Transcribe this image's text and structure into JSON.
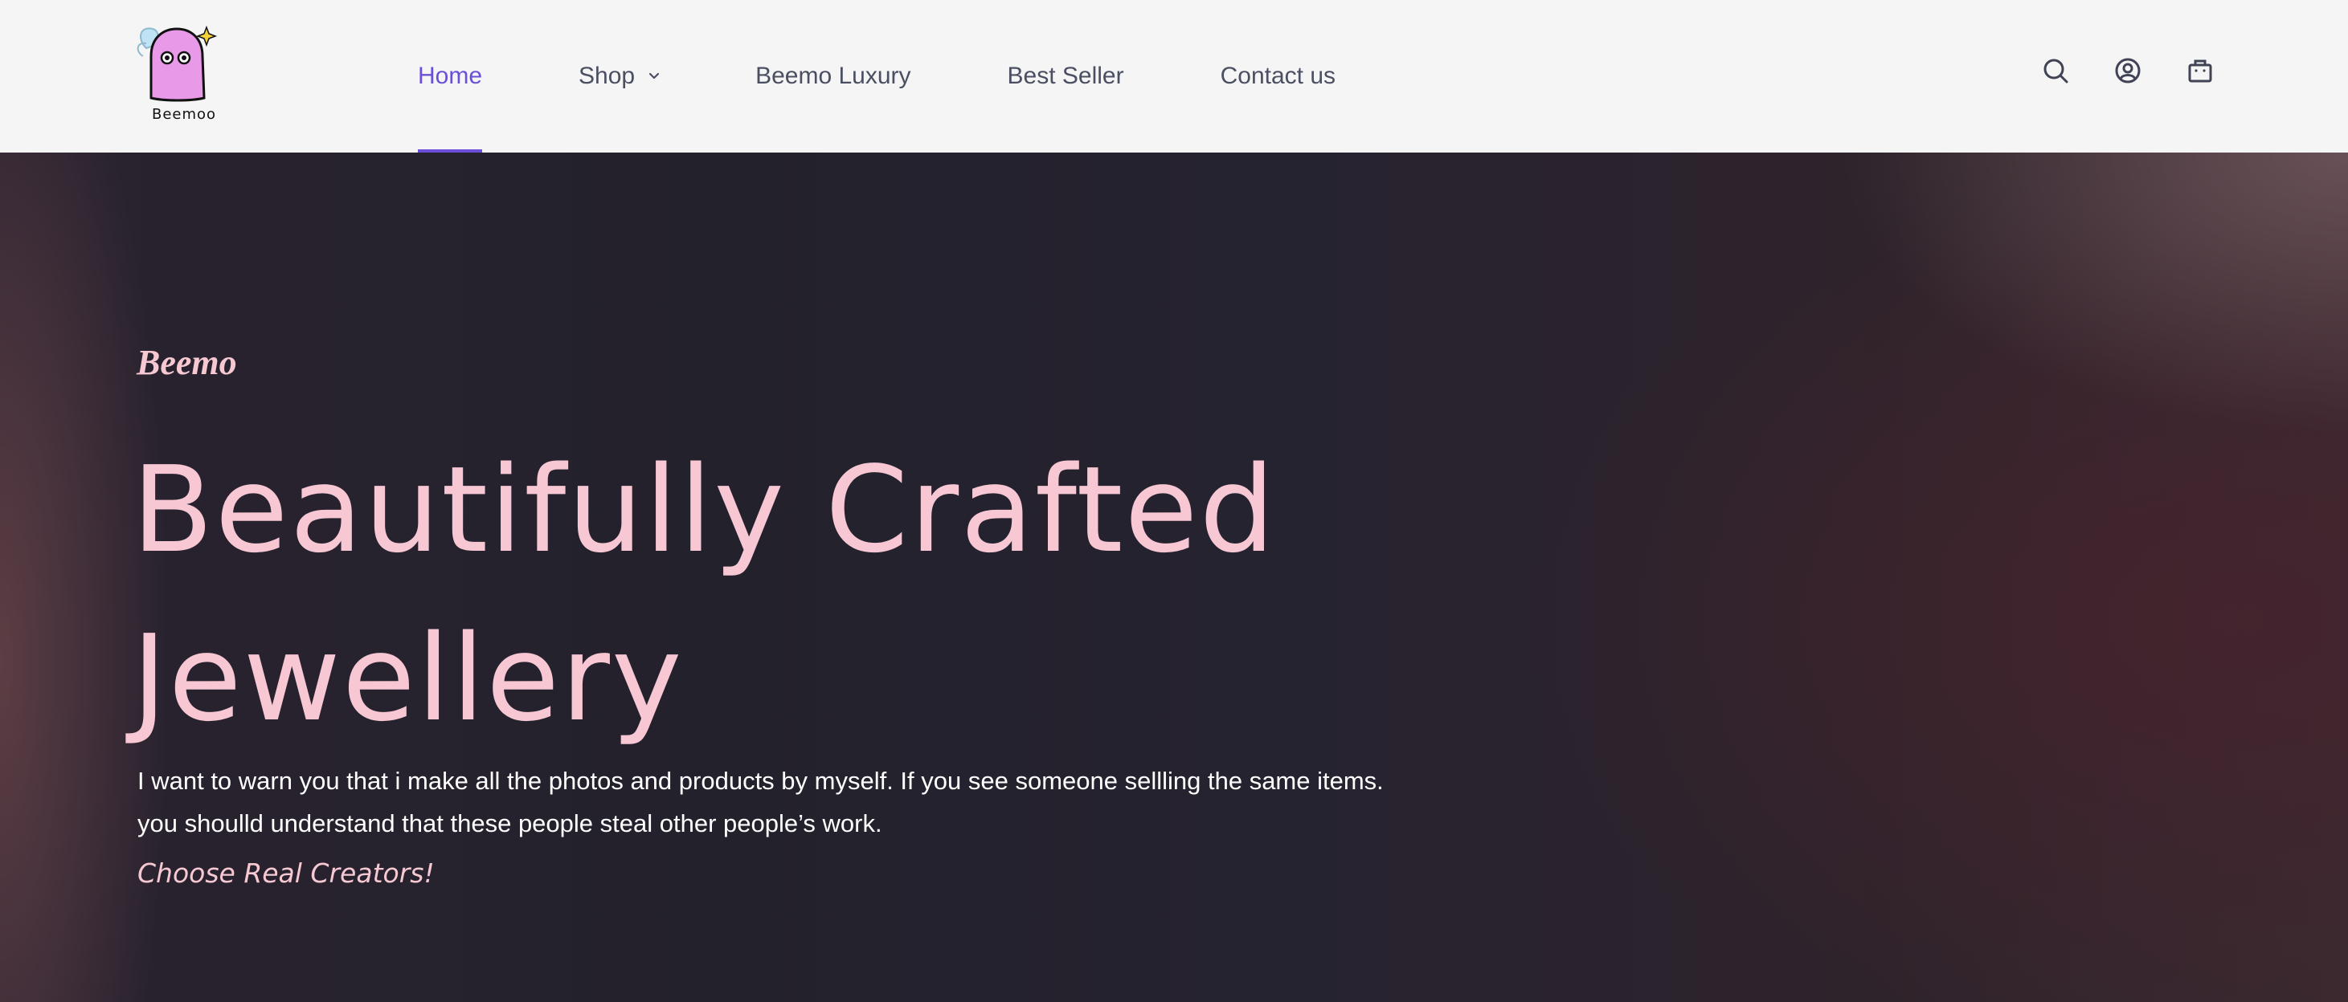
{
  "brand": {
    "logo_text": "Beemoo"
  },
  "nav": {
    "items": [
      {
        "label": "Home",
        "active": true
      },
      {
        "label": "Shop",
        "has_dropdown": true
      },
      {
        "label": "Beemo Luxury"
      },
      {
        "label": "Best Seller"
      },
      {
        "label": "Contact us"
      }
    ]
  },
  "header_icons": [
    "search-icon",
    "account-icon",
    "cart-icon"
  ],
  "hero": {
    "eyebrow": "Beemo",
    "title": "Beautifully Crafted Jewellery",
    "warning": "I want to warn you that i make all the photos and products by myself. If you see someone sellling the same items. you shoulld understand that these people steal other people’s work.",
    "cta": "Choose Real Creators!"
  },
  "colors": {
    "accent": "#6b4fd8",
    "nav_text": "#4a4f61",
    "hero_pink": "#f7c7d3",
    "header_bg": "#f5f5f5",
    "hero_bg": "#25222d",
    "logo_body": "#e89ae8"
  }
}
